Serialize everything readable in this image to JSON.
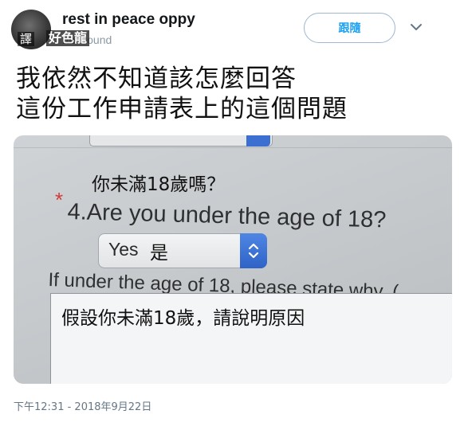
{
  "author": {
    "display_name": "rest in peace oppy",
    "handle": "rthesound",
    "avatar_overlay_text": "譯",
    "handle_overlay_text": "好色龍"
  },
  "follow_button_label": "跟隨",
  "tweet_lines": [
    "我依然不知道該怎麼回答",
    "這份工作申請表上的這個問題"
  ],
  "photo": {
    "translation_question": "你未滿18歲嗎？",
    "asterisk": "*",
    "question": "4.Are you under the age of 18?",
    "select_value": "Yes",
    "select_translation": "是",
    "why_line": "If under the age of 18, please state why. (",
    "translation_why": "假設你未滿18歲，請說明原因"
  },
  "timestamp": "下午12:31 - 2018年9月22日",
  "colors": {
    "follow_blue": "#1da1f2",
    "stepper_blue": "#3b6fd0",
    "asterisk_red": "#d23a3a",
    "timestamp_gray": "#657786"
  },
  "icons": [
    "chevron-down-icon",
    "stepper-icon"
  ]
}
